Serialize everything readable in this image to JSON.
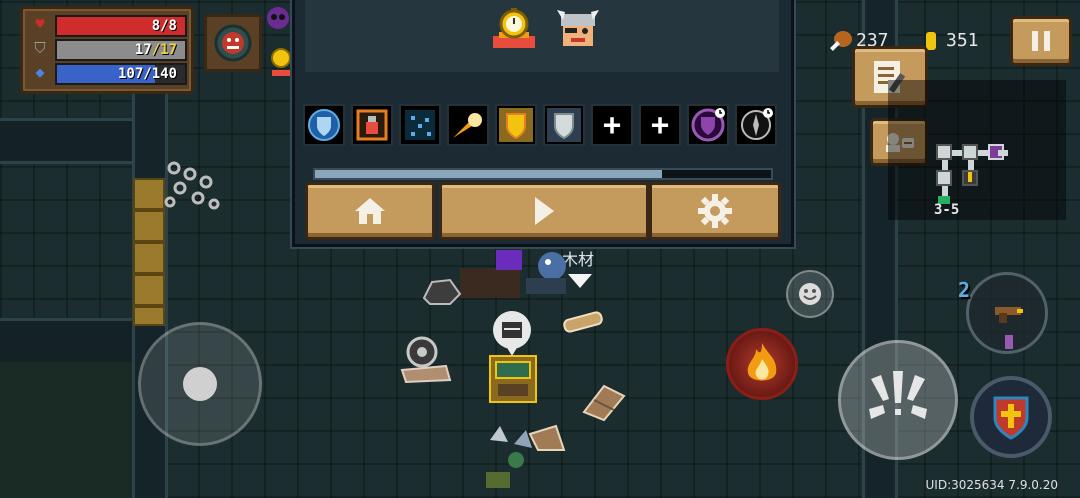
{
  "player_stats": {
    "hp": "8/8",
    "armor_current": "17",
    "armor_sep_max": "/17",
    "energy": "107/140",
    "hp_ratio": 1.0,
    "armor_ratio": 1.0,
    "energy_ratio": 0.764
  },
  "resources": {
    "materials": "237",
    "coins": "351"
  },
  "minimap": {
    "level": "3-5"
  },
  "pause_panel": {
    "skill_slots": [
      {
        "icon": "shield-buff-icon",
        "glyph": ""
      },
      {
        "icon": "potion-card-icon",
        "glyph": ""
      },
      {
        "icon": "stars-icon",
        "glyph": ""
      },
      {
        "icon": "comet-icon",
        "glyph": ""
      },
      {
        "icon": "golden-shield-icon",
        "glyph": ""
      },
      {
        "icon": "silver-shield-icon",
        "glyph": ""
      },
      {
        "icon": "empty-slot-plus-icon",
        "glyph": "+"
      },
      {
        "icon": "empty-slot-plus-icon",
        "glyph": "+"
      },
      {
        "icon": "timed-purple-shield-icon",
        "glyph": ""
      },
      {
        "icon": "timed-compass-icon",
        "glyph": ""
      }
    ],
    "progress_ratio": 0.76,
    "buttons": [
      "home",
      "resume",
      "settings"
    ]
  },
  "world_labels": {
    "wood_label": "木材"
  },
  "weapon": {
    "energy_cost": "2"
  },
  "uid": "UID:3025634 7.9.0.20",
  "colors": {
    "hp": "#d02c2c",
    "armor": "#8c8c8c",
    "energy": "#3a63c9",
    "armor_max_text": "#f2d23a"
  }
}
